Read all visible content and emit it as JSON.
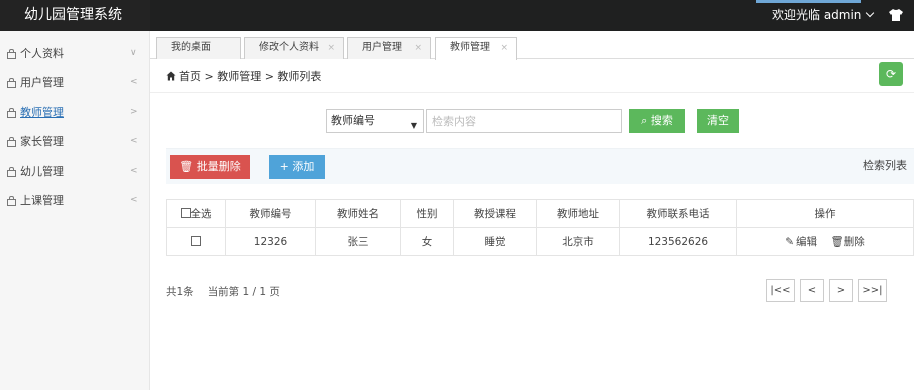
{
  "app": {
    "title": "幼儿园管理系统"
  },
  "header": {
    "welcome": "欢迎光临 admin"
  },
  "sidebar": {
    "items": [
      {
        "label": "个人资料",
        "arrow": "∨"
      },
      {
        "label": "用户管理",
        "arrow": "<"
      },
      {
        "label": "教师管理",
        "arrow": ">"
      },
      {
        "label": "家长管理",
        "arrow": "<"
      },
      {
        "label": "幼儿管理",
        "arrow": "<"
      },
      {
        "label": "上课管理",
        "arrow": "<"
      }
    ]
  },
  "tabs": [
    {
      "label": "我的桌面"
    },
    {
      "label": "修改个人资料",
      "close": "×"
    },
    {
      "label": "用户管理",
      "close": "×"
    },
    {
      "label": "教师管理",
      "close": "×"
    }
  ],
  "breadcrumb": {
    "text": "首页 > 教师管理 > 教师列表"
  },
  "search": {
    "select_value": "教师编号",
    "placeholder": "检索内容",
    "search_label": "搜索",
    "clear_label": "清空"
  },
  "toolbar": {
    "batch_delete_label": "批量删除",
    "add_label": "添加",
    "list_title": "检索列表"
  },
  "table": {
    "select_all": "全选",
    "columns": [
      "教师编号",
      "教师姓名",
      "性别",
      "教授课程",
      "教师地址",
      "教师联系电话",
      "操作"
    ],
    "rows": [
      {
        "id": "12326",
        "name": "张三",
        "gender": "女",
        "course": "睡觉",
        "address": "北京市",
        "phone": "123562626",
        "edit": "编辑",
        "delete": "删除"
      }
    ]
  },
  "pagination": {
    "total": "共1条",
    "current": "当前第 1 / 1 页",
    "first": "|<<",
    "prev": "<",
    "next": ">",
    "last": ">>|"
  },
  "colors": {
    "header_bg": "#1f2020",
    "green": "#5cb85c",
    "red": "#d9534f",
    "blue": "#4fa3d9"
  }
}
